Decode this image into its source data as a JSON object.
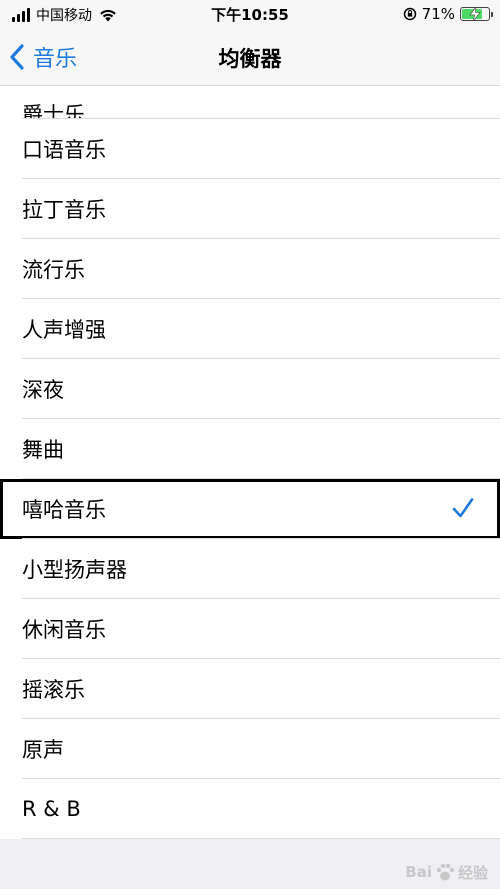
{
  "status_bar": {
    "carrier": "中国移动",
    "time": "下午10:55",
    "battery_percent_label": "71%",
    "battery_level": 0.71
  },
  "nav": {
    "back_label": "音乐",
    "title": "均衡器"
  },
  "list": {
    "items": [
      {
        "label": "爵士乐",
        "selected": false
      },
      {
        "label": "口语音乐",
        "selected": false
      },
      {
        "label": "拉丁音乐",
        "selected": false
      },
      {
        "label": "流行乐",
        "selected": false
      },
      {
        "label": "人声增强",
        "selected": false
      },
      {
        "label": "深夜",
        "selected": false
      },
      {
        "label": "舞曲",
        "selected": false
      },
      {
        "label": "嘻哈音乐",
        "selected": true
      },
      {
        "label": "小型扬声器",
        "selected": false
      },
      {
        "label": "休闲音乐",
        "selected": false
      },
      {
        "label": "摇滚乐",
        "selected": false
      },
      {
        "label": "原声",
        "selected": false
      },
      {
        "label": "R & B",
        "selected": false
      }
    ]
  },
  "watermark": {
    "brand_left": "Bai",
    "brand_right": "经验"
  },
  "colors": {
    "accent": "#1f7ae0",
    "battery": "#4cd964",
    "bar_bg": "#f7f7f7"
  },
  "icons": {
    "back": "chevron-left-icon",
    "check": "checkmark-icon",
    "wifi": "wifi-icon",
    "battery": "battery-charging-icon",
    "orientation": "orientation-lock-icon"
  }
}
